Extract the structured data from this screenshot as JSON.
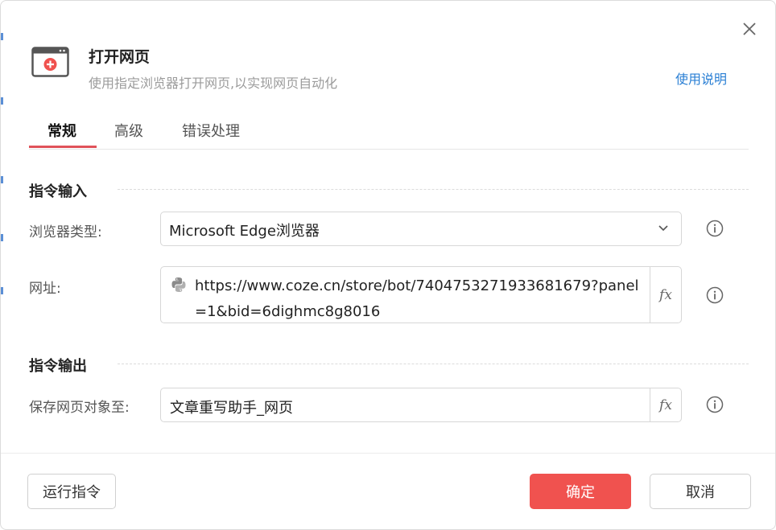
{
  "header": {
    "title": "打开网页",
    "subtitle": "使用指定浏览器打开网页,以实现网页自动化",
    "help_link": "使用说明"
  },
  "tabs": [
    {
      "label": "常规",
      "active": true
    },
    {
      "label": "高级",
      "active": false
    },
    {
      "label": "错误处理",
      "active": false
    }
  ],
  "input_section": {
    "title": "指令输入",
    "browser": {
      "label": "浏览器类型:",
      "value": "Microsoft Edge浏览器"
    },
    "url": {
      "label": "网址:",
      "value": "https://www.coze.cn/store/bot/7404753271933681679?panel=1&bid=6dighmc8g8016",
      "fx": "fx"
    }
  },
  "output_section": {
    "title": "指令输出",
    "save": {
      "label": "保存网页对象至:",
      "value": "文章重写助手_网页",
      "fx": "fx"
    }
  },
  "footer": {
    "run_label": "运行指令",
    "ok_label": "确定",
    "cancel_label": "取消"
  },
  "colors": {
    "accent": "#f0524f",
    "link": "#2a7fd4",
    "tab_underline": "#e0525a"
  },
  "icons": {
    "header": "browser-window-plus-icon",
    "close": "close-icon",
    "dropdown": "chevron-down-icon",
    "python": "python-icon",
    "info": "info-icon"
  }
}
